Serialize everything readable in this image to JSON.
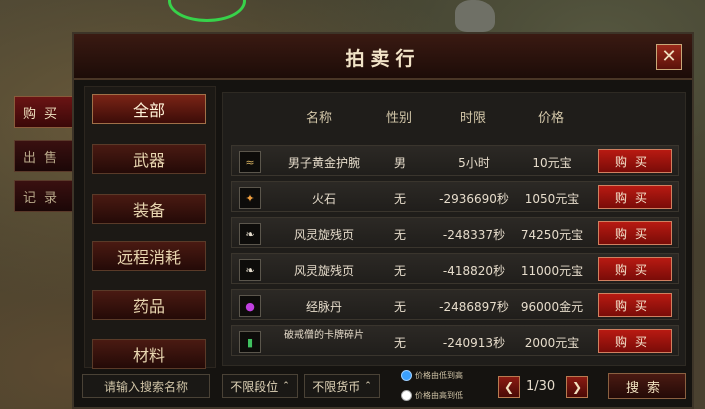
{
  "window": {
    "title": "拍卖行",
    "close_label": "✕"
  },
  "side_tabs": [
    {
      "label": "购买",
      "active": true
    },
    {
      "label": "出售",
      "active": false
    },
    {
      "label": "记录",
      "active": false
    }
  ],
  "categories": [
    "全部",
    "武器",
    "装备",
    "远程消耗",
    "药品",
    "材料"
  ],
  "table": {
    "headers": {
      "name": "名称",
      "gender": "性别",
      "limit": "时限",
      "price": "价格"
    },
    "rows": [
      {
        "icon": "bracer-icon",
        "name": "男子黄金护腕",
        "gender": "男",
        "limit": "5小时",
        "price": "10元宝",
        "buy": "购买"
      },
      {
        "icon": "flint-icon",
        "name": "火石",
        "gender": "无",
        "limit": "-2936690秒",
        "price": "1050元宝",
        "buy": "购买"
      },
      {
        "icon": "scroll-icon",
        "name": "风灵旋残页",
        "gender": "无",
        "limit": "-248337秒",
        "price": "74250元宝",
        "buy": "购买"
      },
      {
        "icon": "scroll-icon",
        "name": "风灵旋残页",
        "gender": "无",
        "limit": "-418820秒",
        "price": "11000元宝",
        "buy": "购买"
      },
      {
        "icon": "pill-icon",
        "name": "经脉丹",
        "gender": "无",
        "limit": "-2486897秒",
        "price": "96000金元",
        "buy": "购买"
      },
      {
        "icon": "card-icon",
        "name": "破戒僧的卡牌碎片",
        "gender": "无",
        "limit": "-240913秒",
        "price": "2000元宝",
        "buy": "购买"
      }
    ]
  },
  "bottom": {
    "search_placeholder": "请输入搜索名称",
    "tier_filter": "不限段位",
    "currency_filter": "不限货币",
    "sort_asc": "价格由低到高",
    "sort_desc": "价格由高到低",
    "page": "1/30",
    "search_button": "搜索"
  }
}
